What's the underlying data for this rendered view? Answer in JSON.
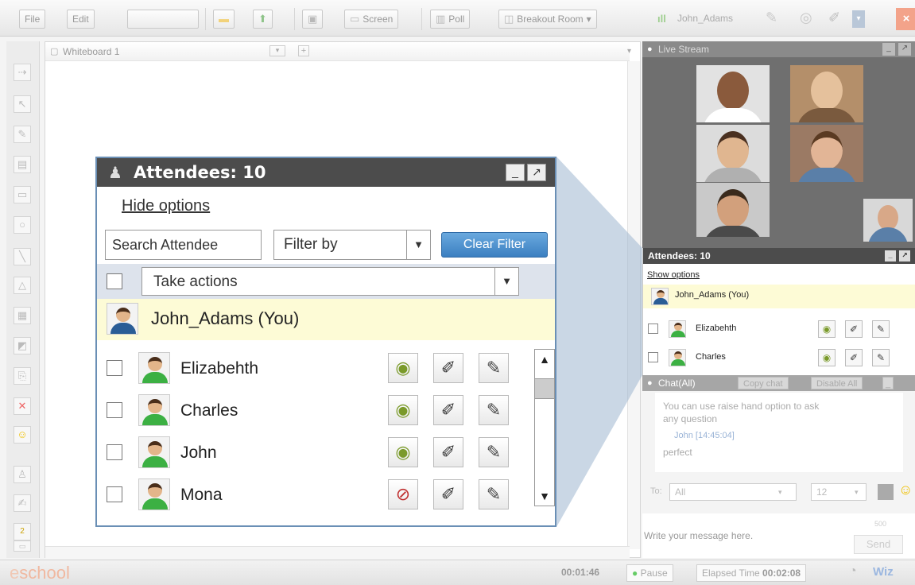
{
  "toolbar": {
    "file": "File",
    "edit": "Edit",
    "screen": "Screen",
    "poll": "Poll",
    "breakout": "Breakout Room",
    "user": "John_Adams"
  },
  "whiteboard": {
    "tab": "Whiteboard 1"
  },
  "attendees_panel": {
    "title": "Attendees: 10",
    "hide_options": "Hide options",
    "search_placeholder": "Search Attendee",
    "filter": "Filter by",
    "clear_filter": "Clear Filter",
    "take_actions": "Take actions",
    "you": "John_Adams (You)",
    "rows": [
      {
        "name": "Elizabehth",
        "webcam": "on"
      },
      {
        "name": "Charles",
        "webcam": "on"
      },
      {
        "name": "John",
        "webcam": "on"
      },
      {
        "name": "Mona",
        "webcam": "off"
      }
    ]
  },
  "live_stream": {
    "title": "Live Stream"
  },
  "right_attendees": {
    "title": "Attendees: 10",
    "show_options": "Show options",
    "you": "John_Adams (You)",
    "rows": [
      "Elizabehth",
      "Charles"
    ]
  },
  "chat": {
    "title": "Chat(All)",
    "copy": "Copy chat",
    "disable": "Disable All",
    "messages": [
      "You can use raise hand option to ask",
      "any question",
      "John [14:45:04]",
      "perfect"
    ],
    "to_label": "To:",
    "to_value": "All",
    "font_size": "12",
    "placeholder": "Write your message here.",
    "char_count": "500",
    "send": "Send"
  },
  "status": {
    "logo_e": "e",
    "logo_rest": "school",
    "timer": "00:01:46",
    "pause": "Pause",
    "elapsed_label": "Elapsed Time",
    "elapsed": "00:02:08",
    "wiz": "Wiz"
  }
}
